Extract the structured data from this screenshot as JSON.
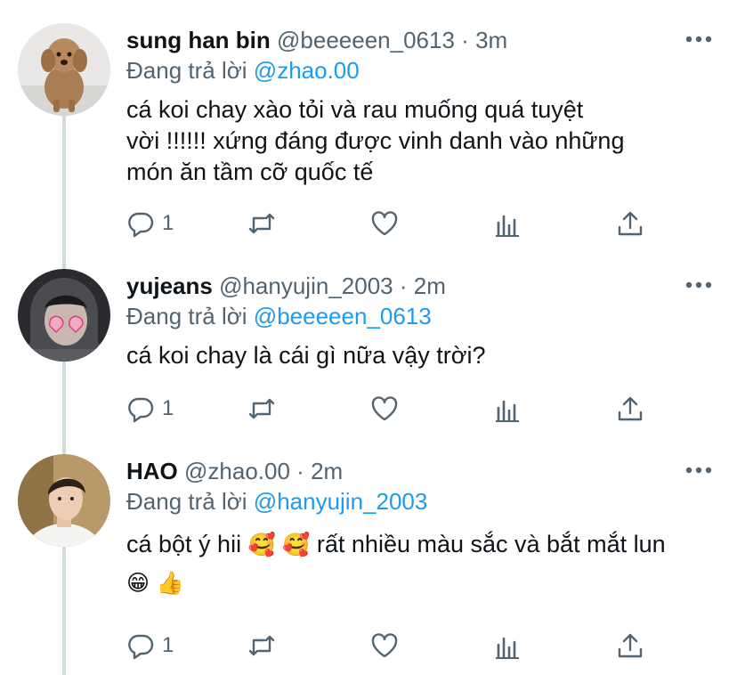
{
  "tweets": [
    {
      "name": "sung han bin",
      "handle": "@beeeeen_0613",
      "dot": "·",
      "time": "3m",
      "reply_prefix": "Đang trả lời",
      "reply_to": "@zhao.00",
      "text_lines": [
        "cá koi chay xào tỏi và rau muống quá tuyệt",
        "vời !!!!!! xứng đáng được vinh danh vào những",
        "món ăn tầm cỡ quốc tế"
      ],
      "reply_count": "1",
      "avatar_icon": "dog-avatar"
    },
    {
      "name": "yujeans",
      "handle": "@hanyujin_2003",
      "dot": "·",
      "time": "2m",
      "reply_prefix": "Đang trả lời",
      "reply_to": "@beeeeen_0613",
      "text_lines": [
        "cá koi chay là cái gì nữa vậy trời?"
      ],
      "reply_count": "1",
      "avatar_icon": "hoodie-heart-glasses-avatar"
    },
    {
      "name": "HAO",
      "handle": "@zhao.00",
      "dot": "·",
      "time": "2m",
      "reply_prefix": "Đang trả lời",
      "reply_to": "@hanyujin_2003",
      "text_line1": "cá bột ý hii",
      "emoji1": "🥰",
      "emoji2": "🥰",
      "text_line1b": "rất nhiều màu sắc và bắt mắt lun",
      "emoji3": "😁",
      "emoji4": "👍",
      "reply_count": "1",
      "avatar_icon": "person-avatar"
    }
  ],
  "colors": {
    "link": "#1d9bf0",
    "secondary_text": "#536471",
    "thread_line": "#cfd9de"
  }
}
